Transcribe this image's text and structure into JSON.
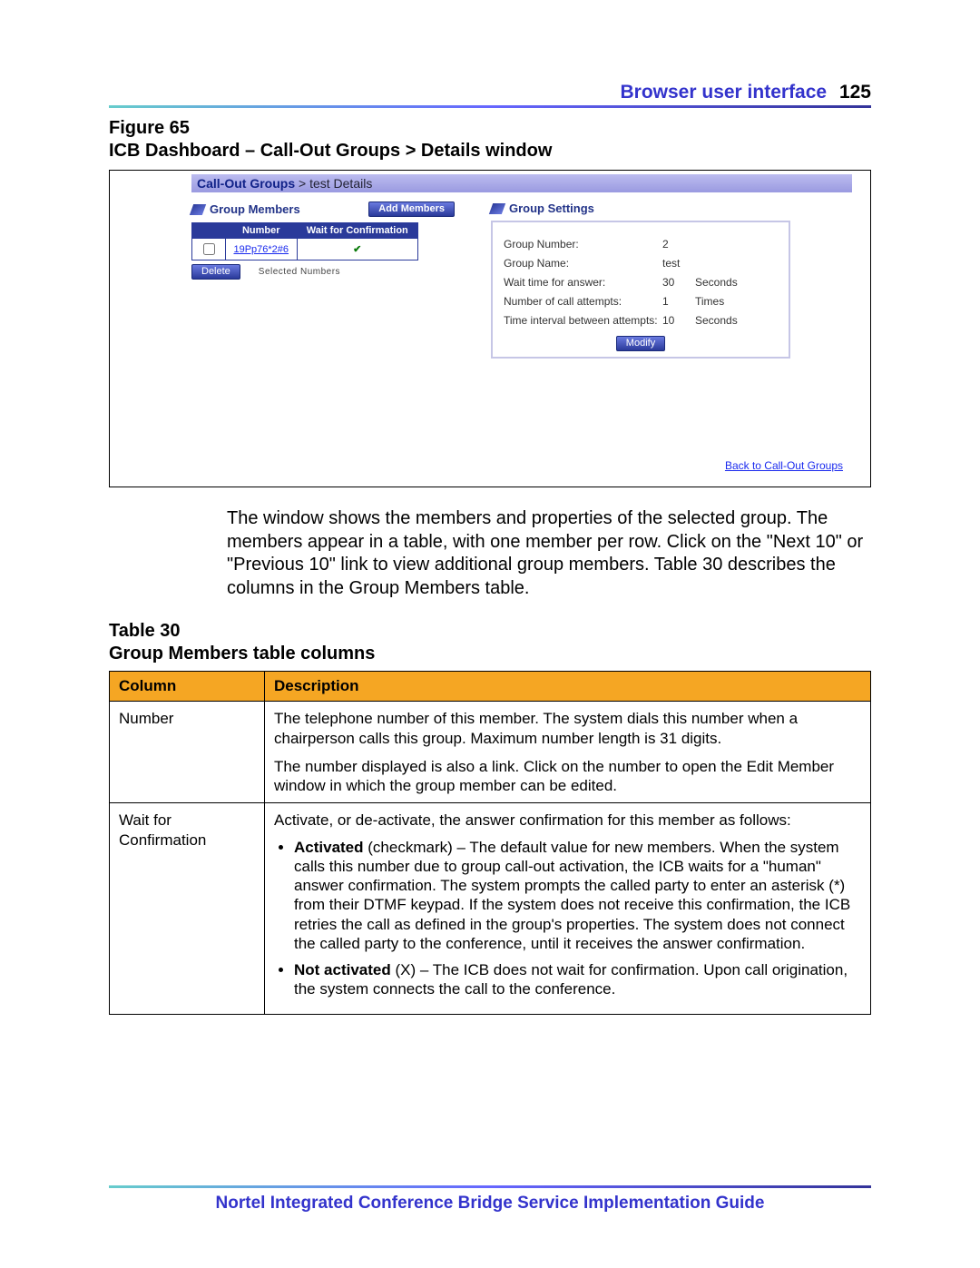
{
  "header": {
    "section_title": "Browser user interface",
    "page_number": "125"
  },
  "figure": {
    "label_line1": "Figure 65",
    "label_line2": "ICB Dashboard – Call-Out Groups > Details window"
  },
  "screenshot": {
    "breadcrumb_strong": "Call-Out Groups",
    "breadcrumb_tail": " > test Details",
    "members_heading": "Group Members",
    "add_members_btn": "Add Members",
    "members_table": {
      "headers": {
        "number": "Number",
        "wait": "Wait for Confirmation"
      },
      "row": {
        "number": "19Pp76*2#6",
        "wait_check": "✔"
      }
    },
    "delete_btn": "Delete",
    "selected_label": "Selected Numbers",
    "settings_heading": "Group Settings",
    "settings": {
      "group_number": {
        "k": "Group Number:",
        "v": "2",
        "u": ""
      },
      "group_name": {
        "k": "Group Name:",
        "v": "test",
        "u": ""
      },
      "wait_time": {
        "k": "Wait time for answer:",
        "v": "30",
        "u": "Seconds"
      },
      "attempts": {
        "k": "Number of call attempts:",
        "v": "1",
        "u": "Times"
      },
      "interval": {
        "k": "Time interval between attempts:",
        "v": "10",
        "u": "Seconds"
      }
    },
    "modify_btn": "Modify",
    "back_link": "Back to Call-Out Groups"
  },
  "paragraph": "The window shows the members and properties of the selected group. The members appear in a table, with one member per row. Click on the \"Next 10\" or \"Previous 10\" link to view additional group members. Table 30 describes the columns in the Group Members table.",
  "table30": {
    "label_line1": "Table 30",
    "label_line2": "Group Members table columns",
    "headers": {
      "col": "Column",
      "desc": "Description"
    },
    "rows": {
      "number": {
        "col": "Number",
        "p1": "The telephone number of this member. The system dials this number when a chairperson calls this group. Maximum number length is 31 digits.",
        "p2": "The number displayed is also a link. Click on the number to open the Edit Member window in which the group member can be edited."
      },
      "wait": {
        "col": "Wait for Confirmation",
        "intro": "Activate, or de-activate, the answer confirmation for this member as follows:",
        "b1_strong": "Activated",
        "b1_rest": " (checkmark) – The default value for new members. When the system calls this number due to group call-out activation, the ICB waits for a \"human\" answer confirmation. The system prompts the called party to enter an asterisk (*) from their DTMF keypad. If the system does not receive this confirmation, the ICB retries the call as defined in the group's properties. The system does not connect the called party to the conference, until it receives the answer confirmation.",
        "b2_strong": "Not activated",
        "b2_rest": " (X) – The ICB does not wait for confirmation. Upon call origination, the system connects the call to the conference."
      }
    }
  },
  "footer": {
    "text": "Nortel Integrated Conference Bridge Service Implementation Guide"
  }
}
